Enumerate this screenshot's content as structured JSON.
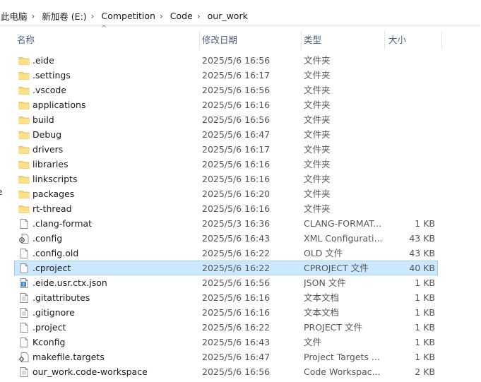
{
  "breadcrumb": [
    "此电脑",
    "新加卷 (E:)",
    "Competition",
    "Code",
    "our_work"
  ],
  "left_pane_fragment": "e",
  "columns": {
    "name": "名称",
    "date": "修改日期",
    "type": "类型",
    "size": "大小"
  },
  "sort_indicator": "^",
  "files": [
    {
      "name": ".eide",
      "date": "2025/5/6 16:56",
      "type": "文件夹",
      "size": "",
      "icon": "folder-icon"
    },
    {
      "name": ".settings",
      "date": "2025/5/6 16:17",
      "type": "文件夹",
      "size": "",
      "icon": "folder-icon"
    },
    {
      "name": ".vscode",
      "date": "2025/5/6 16:56",
      "type": "文件夹",
      "size": "",
      "icon": "folder-icon"
    },
    {
      "name": "applications",
      "date": "2025/5/6 16:16",
      "type": "文件夹",
      "size": "",
      "icon": "folder-icon"
    },
    {
      "name": "build",
      "date": "2025/5/6 16:56",
      "type": "文件夹",
      "size": "",
      "icon": "folder-icon"
    },
    {
      "name": "Debug",
      "date": "2025/5/6 16:47",
      "type": "文件夹",
      "size": "",
      "icon": "folder-icon"
    },
    {
      "name": "drivers",
      "date": "2025/5/6 16:17",
      "type": "文件夹",
      "size": "",
      "icon": "folder-icon"
    },
    {
      "name": "libraries",
      "date": "2025/5/6 16:16",
      "type": "文件夹",
      "size": "",
      "icon": "folder-icon"
    },
    {
      "name": "linkscripts",
      "date": "2025/5/6 16:16",
      "type": "文件夹",
      "size": "",
      "icon": "folder-icon"
    },
    {
      "name": "packages",
      "date": "2025/5/6 16:20",
      "type": "文件夹",
      "size": "",
      "icon": "folder-icon"
    },
    {
      "name": "rt-thread",
      "date": "2025/5/6 16:16",
      "type": "文件夹",
      "size": "",
      "icon": "folder-icon"
    },
    {
      "name": ".clang-format",
      "date": "2025/5/3 16:36",
      "type": "CLANG-FORMAT...",
      "size": "1 KB",
      "icon": "file-icon"
    },
    {
      "name": ".config",
      "date": "2025/5/6 16:43",
      "type": "XML Configurati...",
      "size": "43 KB",
      "icon": "xml-config-icon"
    },
    {
      "name": ".config.old",
      "date": "2025/5/6 16:22",
      "type": "OLD 文件",
      "size": "43 KB",
      "icon": "file-icon"
    },
    {
      "name": ".cproject",
      "date": "2025/5/6 16:22",
      "type": "CPROJECT 文件",
      "size": "40 KB",
      "icon": "file-icon",
      "selected": true
    },
    {
      "name": ".eide.usr.ctx.json",
      "date": "2025/5/6 16:56",
      "type": "JSON 文件",
      "size": "1 KB",
      "icon": "json-file-icon"
    },
    {
      "name": ".gitattributes",
      "date": "2025/5/6 16:16",
      "type": "文本文档",
      "size": "1 KB",
      "icon": "text-file-icon"
    },
    {
      "name": ".gitignore",
      "date": "2025/5/6 16:16",
      "type": "文本文档",
      "size": "1 KB",
      "icon": "text-file-icon"
    },
    {
      "name": ".project",
      "date": "2025/5/6 16:22",
      "type": "PROJECT 文件",
      "size": "1 KB",
      "icon": "file-icon"
    },
    {
      "name": "Kconfig",
      "date": "2025/5/6 16:43",
      "type": "文件",
      "size": "1 KB",
      "icon": "file-icon"
    },
    {
      "name": "makefile.targets",
      "date": "2025/5/6 16:47",
      "type": "Project Targets ...",
      "size": "1 KB",
      "icon": "project-targets-icon"
    },
    {
      "name": "our_work.code-workspace",
      "date": "2025/5/6 16:56",
      "type": "Code Workspac...",
      "size": "2 KB",
      "icon": "text-file-icon"
    }
  ],
  "colors": {
    "selection_bg": "#cce8ff",
    "selection_border": "#99d1ff",
    "folder": "#f8d775",
    "header_text": "#4c607a"
  }
}
